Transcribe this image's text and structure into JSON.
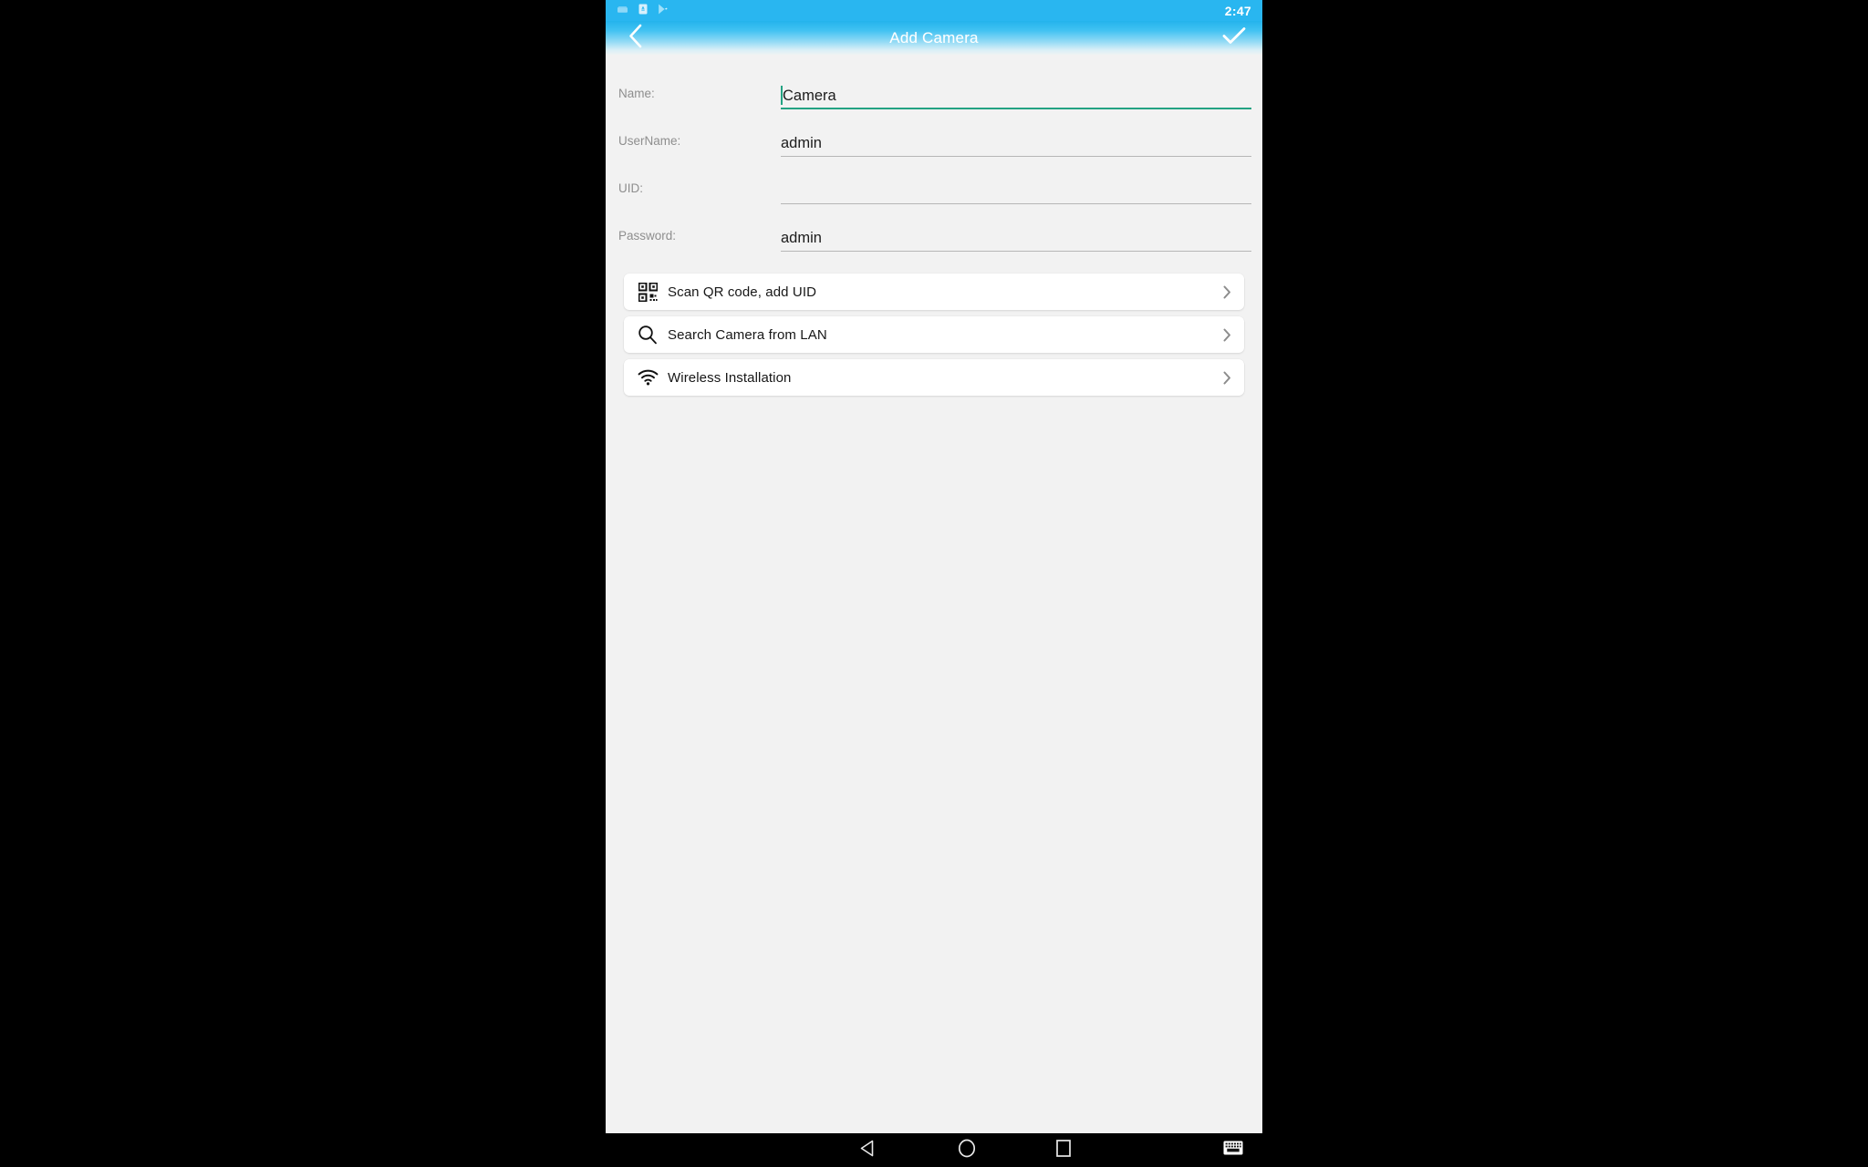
{
  "status_bar": {
    "time": "2:47",
    "icons": [
      "sd-card-icon",
      "sim-card-icon",
      "play-store-icon"
    ]
  },
  "title_bar": {
    "back_icon": "chevron-left-icon",
    "title": "Add Camera",
    "confirm_icon": "check-icon"
  },
  "form": {
    "fields": [
      {
        "label": "Name:",
        "value": "Camera",
        "focused": true,
        "has_caret": true
      },
      {
        "label": "UserName:",
        "value": "admin",
        "focused": false,
        "has_caret": false
      },
      {
        "label": "UID:",
        "value": "",
        "focused": false,
        "has_caret": false
      },
      {
        "label": "Password:",
        "value": "admin",
        "focused": false,
        "has_caret": false
      }
    ]
  },
  "actions": {
    "items": [
      {
        "label": "Scan QR code, add UID",
        "icon": "qr-code-icon",
        "chevron": "chevron-right-icon"
      },
      {
        "label": "Search Camera from LAN",
        "icon": "search-icon",
        "chevron": "chevron-right-icon"
      },
      {
        "label": "Wireless Installation",
        "icon": "wifi-icon",
        "chevron": "chevron-right-icon"
      }
    ]
  },
  "nav_bar": {
    "back": "back-triangle-icon",
    "home": "home-circle-icon",
    "recents": "recents-square-icon",
    "keyboard": "keyboard-icon"
  },
  "colors": {
    "status_bar": "#29b6f0",
    "title_bar_top": "#24b3ec",
    "accent_focus": "#24a383",
    "background": "#f2f2f2",
    "card": "#ffffff"
  }
}
